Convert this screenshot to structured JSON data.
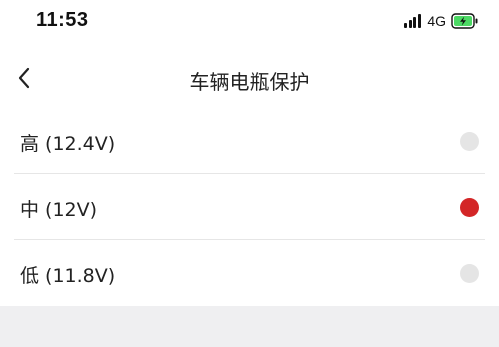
{
  "status_bar": {
    "time": "11:53",
    "network": "4G",
    "signal_icon": "cellular-signal-icon",
    "battery_icon": "battery-charging-icon",
    "battery_color": "#4cd964"
  },
  "nav": {
    "back_icon": "chevron-left-icon",
    "title": "车辆电瓶保护"
  },
  "options": [
    {
      "label": "高 (12.4V)",
      "selected": false
    },
    {
      "label": "中 (12V)",
      "selected": true
    },
    {
      "label": "低 (11.8V)",
      "selected": false
    }
  ],
  "colors": {
    "selected": "#d32627",
    "unselected": "#e5e5e5",
    "footer_bg": "#efeff1"
  }
}
